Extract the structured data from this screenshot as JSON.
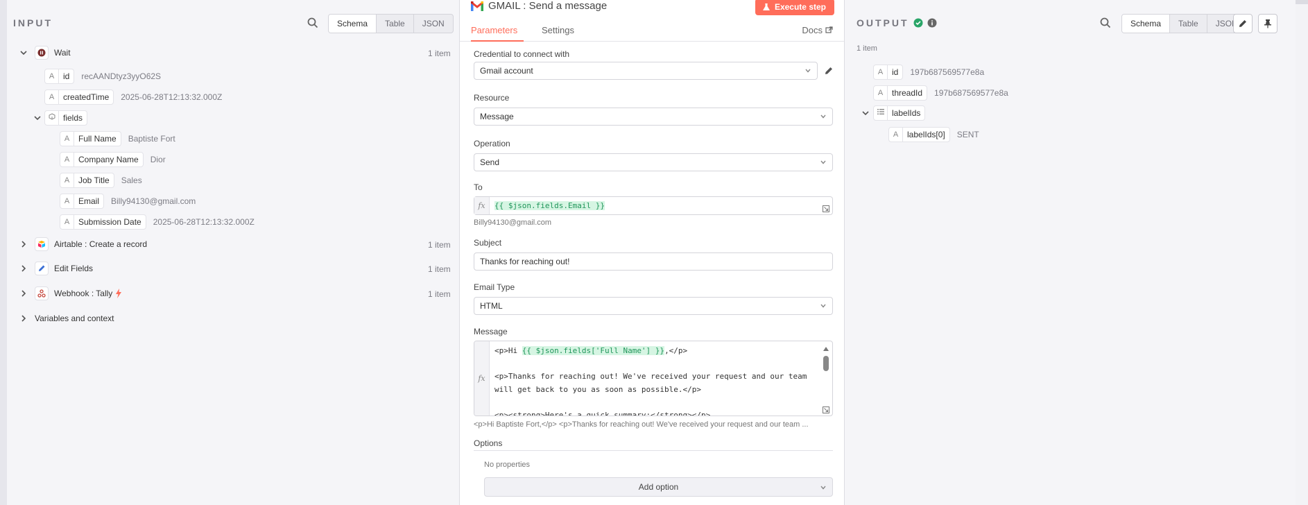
{
  "input": {
    "title": "INPUT",
    "view_tabs": [
      "Schema",
      "Table",
      "JSON"
    ],
    "wait": {
      "label": "Wait",
      "count": "1 item"
    },
    "fields": [
      {
        "key": "id",
        "value": "recAANDtyz3yyO62S"
      },
      {
        "key": "createdTime",
        "value": "2025-06-28T12:13:32.000Z"
      }
    ],
    "fields_obj": {
      "key": "fields"
    },
    "sub_fields": [
      {
        "key": "Full Name",
        "value": "Baptiste Fort"
      },
      {
        "key": "Company Name",
        "value": "Dior"
      },
      {
        "key": "Job Title",
        "value": "Sales"
      },
      {
        "key": "Email",
        "value": "Billy94130@gmail.com"
      },
      {
        "key": "Submission Date",
        "value": "2025-06-28T12:13:32.000Z"
      }
    ],
    "nodes": [
      {
        "label": "Airtable : Create a record",
        "count": "1 item"
      },
      {
        "label": "Edit Fields",
        "count": "1 item"
      },
      {
        "label": "Webhook : Tally",
        "count": "1 item"
      }
    ],
    "variables_label": "Variables and context"
  },
  "center": {
    "title": "GMAIL : Send a message",
    "execute_label": "Execute step",
    "tabs": {
      "parameters": "Parameters",
      "settings": "Settings",
      "docs": "Docs"
    },
    "credential": {
      "label": "Credential to connect with",
      "value": "Gmail account"
    },
    "resource": {
      "label": "Resource",
      "value": "Message"
    },
    "operation": {
      "label": "Operation",
      "value": "Send"
    },
    "to": {
      "label": "To",
      "expr": "{{ $json.fields.Email }}",
      "hint": "Billy94130@gmail.com"
    },
    "subject": {
      "label": "Subject",
      "value": "Thanks for reaching out!"
    },
    "email_type": {
      "label": "Email Type",
      "value": "HTML"
    },
    "message": {
      "label": "Message",
      "line1_pre": "<p>Hi ",
      "line1_expr": "{{ $json.fields['Full Name'] }}",
      "line1_post": ",</p>",
      "line2": "<p>Thanks for reaching out! We've received your request and our team",
      "line3": "will get back to you as soon as possible.</p>",
      "line4": "<p><strong>Here's a quick summary:</strong></p>",
      "hint": "<p>Hi Baptiste Fort,</p> <p>Thanks for reaching out! We've received your request and our team ..."
    },
    "options": {
      "label": "Options",
      "empty": "No properties",
      "add_label": "Add option"
    }
  },
  "output": {
    "title": "OUTPUT",
    "item_count": "1 item",
    "view_tabs": [
      "Schema",
      "Table",
      "JSON"
    ],
    "fields": [
      {
        "key": "id",
        "value": "197b687569577e8a"
      },
      {
        "key": "threadId",
        "value": "197b687569577e8a"
      }
    ],
    "label_ids": {
      "key": "labelIds"
    },
    "label_item": {
      "key": "labelIds[0]",
      "value": "SENT"
    }
  },
  "colors": {
    "accent": "#ff6d5a",
    "success": "#29a568",
    "expr_bg": "#d6f5e3"
  }
}
